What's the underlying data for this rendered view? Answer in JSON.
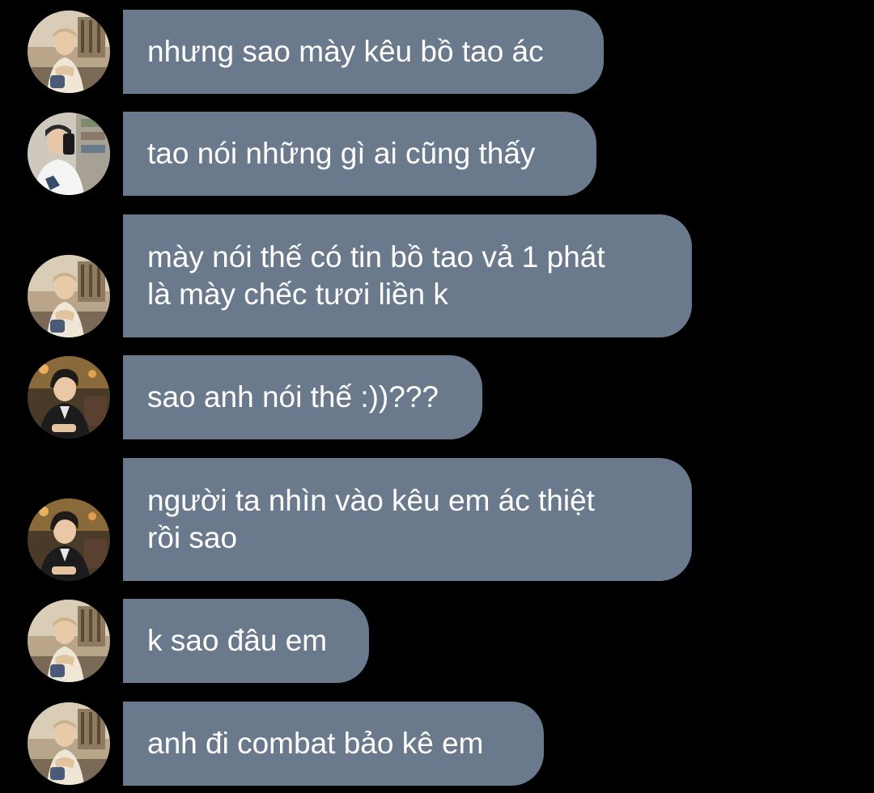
{
  "colors": {
    "background": "#000000",
    "bubble": "#6a7a8c",
    "text": "#ffffff"
  },
  "messages": [
    {
      "avatar": "avatar-blond-cafe",
      "lines": [
        "nhưng sao mày kêu bồ tao ác"
      ]
    },
    {
      "avatar": "avatar-mirror-selfie",
      "lines": [
        "tao nói những gì ai cũng thấy"
      ]
    },
    {
      "avatar": "avatar-blond-cafe",
      "lines": [
        "mày nói thế có tin bồ tao vả 1 phát",
        "là mày chếc tươi liền k"
      ]
    },
    {
      "avatar": "avatar-dark-jacket",
      "lines": [
        "sao anh nói thế :))???"
      ]
    },
    {
      "avatar": "avatar-dark-jacket",
      "lines": [
        "người ta nhìn vào kêu em ác thiệt",
        "rồi sao"
      ]
    },
    {
      "avatar": "avatar-blond-cafe",
      "lines": [
        "k sao đâu em"
      ]
    },
    {
      "avatar": "avatar-blond-cafe",
      "lines": [
        "anh đi combat bảo kê em"
      ]
    }
  ]
}
